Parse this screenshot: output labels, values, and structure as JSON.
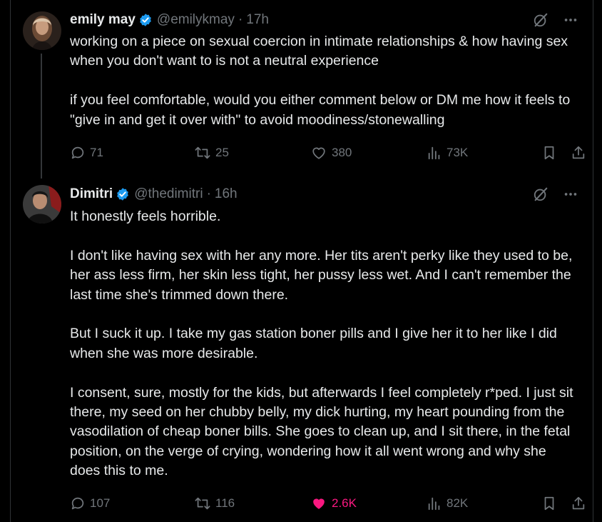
{
  "tweets": [
    {
      "name": "emily may",
      "handle": "@emilykmay",
      "separator": "·",
      "time": "17h",
      "paragraphs": [
        "working on a piece on sexual coercion in intimate relationships & how having sex when you don't want to is not a neutral experience",
        "if you feel comfortable, would you either comment below or DM me how it feels to \"give in and get it over with\" to avoid moodiness/stonewalling"
      ],
      "replies": "71",
      "reposts": "25",
      "likes": "380",
      "views": "73K",
      "liked": false
    },
    {
      "name": "Dimitri",
      "handle": "@thedimitri",
      "separator": "·",
      "time": "16h",
      "paragraphs": [
        "It honestly feels horrible.",
        "I don't like having sex with her any more. Her tits aren't perky like they used to be, her ass less firm, her skin less tight, her pussy less wet. And I can't remember the last time she's trimmed down there.",
        "But I suck it up. I take my gas station boner pills and I give her it to her like I did when she was more desirable.",
        "I consent, sure, mostly for the kids, but afterwards I feel completely r*ped. I just sit there, my seed on her chubby belly, my dick hurting, my heart pounding from the vasodilation of cheap boner bills. She goes to clean up, and I sit there, in the fetal position, on the verge of crying, wondering how it all went wrong and why she does this to me."
      ],
      "replies": "107",
      "reposts": "116",
      "likes": "2.6K",
      "views": "82K",
      "liked": true
    }
  ],
  "icons": {
    "verified": "verified-badge-icon",
    "grok": "grok-icon",
    "more": "more-icon",
    "reply": "reply-icon",
    "repost": "repost-icon",
    "like": "like-icon",
    "views": "views-icon",
    "bookmark": "bookmark-icon",
    "share": "share-icon"
  },
  "colors": {
    "background": "#000000",
    "text": "#e7e9ea",
    "muted": "#71767b",
    "verified": "#1d9bf0",
    "like": "#f91880",
    "divider": "#2f3336"
  }
}
